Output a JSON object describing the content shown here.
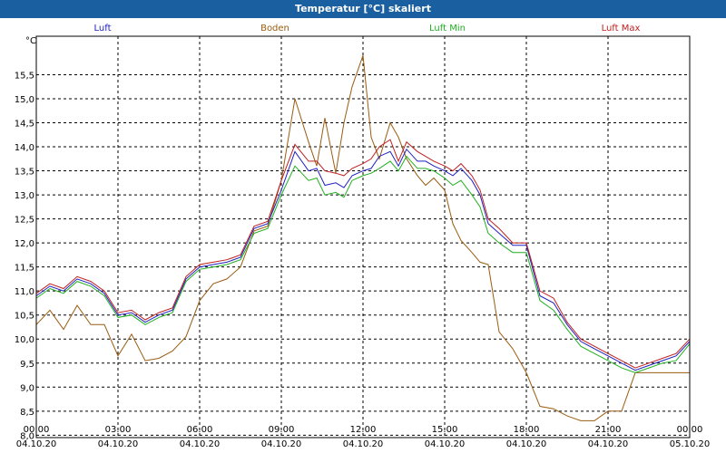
{
  "window": {
    "title": "Temperatur [°C] skaliert"
  },
  "chart_data": {
    "type": "line",
    "title": "Temperatur [°C] skaliert",
    "ylabel": "°C",
    "xlabel": "",
    "ylim": [
      7.95,
      16.3
    ],
    "xlim": [
      0,
      24
    ],
    "grid": true,
    "legend_placement": "top",
    "y_ticks": [
      "8,0",
      "8,5",
      "9,0",
      "9,5",
      "10,0",
      "10,5",
      "11,0",
      "11,5",
      "12,0",
      "12,5",
      "13,0",
      "13,5",
      "14,0",
      "14,5",
      "15,0",
      "15,5"
    ],
    "x_ticks": [
      {
        "time": "00:00",
        "date": "04.10.20"
      },
      {
        "time": "03:00",
        "date": "04.10.20"
      },
      {
        "time": "06:00",
        "date": "04.10.20"
      },
      {
        "time": "09:00",
        "date": "04.10.20"
      },
      {
        "time": "12:00",
        "date": "04.10.20"
      },
      {
        "time": "15:00",
        "date": "04.10.20"
      },
      {
        "time": "18:00",
        "date": "04.10.20"
      },
      {
        "time": "21:00",
        "date": "04.10.20"
      },
      {
        "time": "00:00",
        "date": "05.10.20"
      }
    ],
    "x_hours": [
      0,
      0.5,
      1,
      1.5,
      2,
      2.5,
      3,
      3.5,
      4,
      4.5,
      5,
      5.5,
      6,
      6.5,
      7,
      7.5,
      8,
      8.5,
      9,
      9.5,
      10,
      10.3,
      10.6,
      11,
      11.3,
      11.6,
      12,
      12.3,
      12.6,
      13,
      13.3,
      13.6,
      14,
      14.3,
      14.6,
      15,
      15.3,
      15.6,
      16,
      16.3,
      16.6,
      17,
      17.5,
      18,
      18.5,
      19,
      19.5,
      20,
      20.5,
      21,
      21.5,
      22,
      22.5,
      23,
      23.5,
      24
    ],
    "series": [
      {
        "name": "Luft",
        "color": "#2020c0",
        "values": [
          10.9,
          11.1,
          11.0,
          11.25,
          11.15,
          10.95,
          10.5,
          10.55,
          10.35,
          10.5,
          10.6,
          11.25,
          11.5,
          11.55,
          11.6,
          11.7,
          12.3,
          12.4,
          13.1,
          13.9,
          13.5,
          13.55,
          13.2,
          13.25,
          13.15,
          13.4,
          13.5,
          13.55,
          13.8,
          13.9,
          13.6,
          13.95,
          13.7,
          13.7,
          13.6,
          13.5,
          13.4,
          13.55,
          13.3,
          13.0,
          12.4,
          12.2,
          11.95,
          11.95,
          10.9,
          10.75,
          10.3,
          9.95,
          9.8,
          9.65,
          9.5,
          9.35,
          9.45,
          9.55,
          9.65,
          9.95
        ]
      },
      {
        "name": "Boden",
        "color": "#9a5c10",
        "values": [
          10.3,
          10.6,
          10.2,
          10.7,
          10.3,
          10.3,
          9.65,
          10.1,
          9.55,
          9.6,
          9.75,
          10.05,
          10.8,
          11.15,
          11.25,
          11.5,
          12.25,
          12.35,
          13.3,
          15.0,
          14.1,
          13.6,
          14.6,
          13.45,
          14.5,
          15.25,
          15.9,
          14.2,
          13.75,
          14.5,
          14.2,
          13.75,
          13.4,
          13.2,
          13.35,
          13.1,
          12.4,
          12.05,
          11.8,
          11.6,
          11.55,
          10.15,
          9.8,
          9.3,
          8.6,
          8.55,
          8.4,
          8.3,
          8.3,
          8.5,
          8.5,
          9.3,
          9.3,
          9.3,
          9.3,
          9.3
        ]
      },
      {
        "name": "Luft Min",
        "color": "#20b020",
        "values": [
          10.85,
          11.05,
          10.95,
          11.2,
          11.1,
          10.9,
          10.45,
          10.5,
          10.3,
          10.45,
          10.55,
          11.2,
          11.45,
          11.5,
          11.55,
          11.65,
          12.2,
          12.3,
          13.0,
          13.6,
          13.3,
          13.35,
          13.0,
          13.05,
          12.95,
          13.3,
          13.4,
          13.45,
          13.55,
          13.7,
          13.5,
          13.8,
          13.55,
          13.55,
          13.5,
          13.35,
          13.2,
          13.3,
          13.0,
          12.75,
          12.2,
          12.0,
          11.8,
          11.8,
          10.8,
          10.6,
          10.2,
          9.85,
          9.7,
          9.55,
          9.4,
          9.3,
          9.4,
          9.5,
          9.55,
          9.9
        ]
      },
      {
        "name": "Luft Max",
        "color": "#c02020",
        "values": [
          10.95,
          11.15,
          11.05,
          11.3,
          11.2,
          11.0,
          10.55,
          10.6,
          10.4,
          10.55,
          10.65,
          11.3,
          11.55,
          11.6,
          11.65,
          11.75,
          12.35,
          12.45,
          13.3,
          14.05,
          13.7,
          13.7,
          13.5,
          13.45,
          13.4,
          13.55,
          13.65,
          13.75,
          14.0,
          14.15,
          13.7,
          14.1,
          13.9,
          13.8,
          13.7,
          13.6,
          13.5,
          13.65,
          13.4,
          13.1,
          12.5,
          12.3,
          12.0,
          12.0,
          11.0,
          10.85,
          10.35,
          10.0,
          9.85,
          9.7,
          9.55,
          9.4,
          9.5,
          9.6,
          9.7,
          10.0
        ]
      }
    ]
  }
}
